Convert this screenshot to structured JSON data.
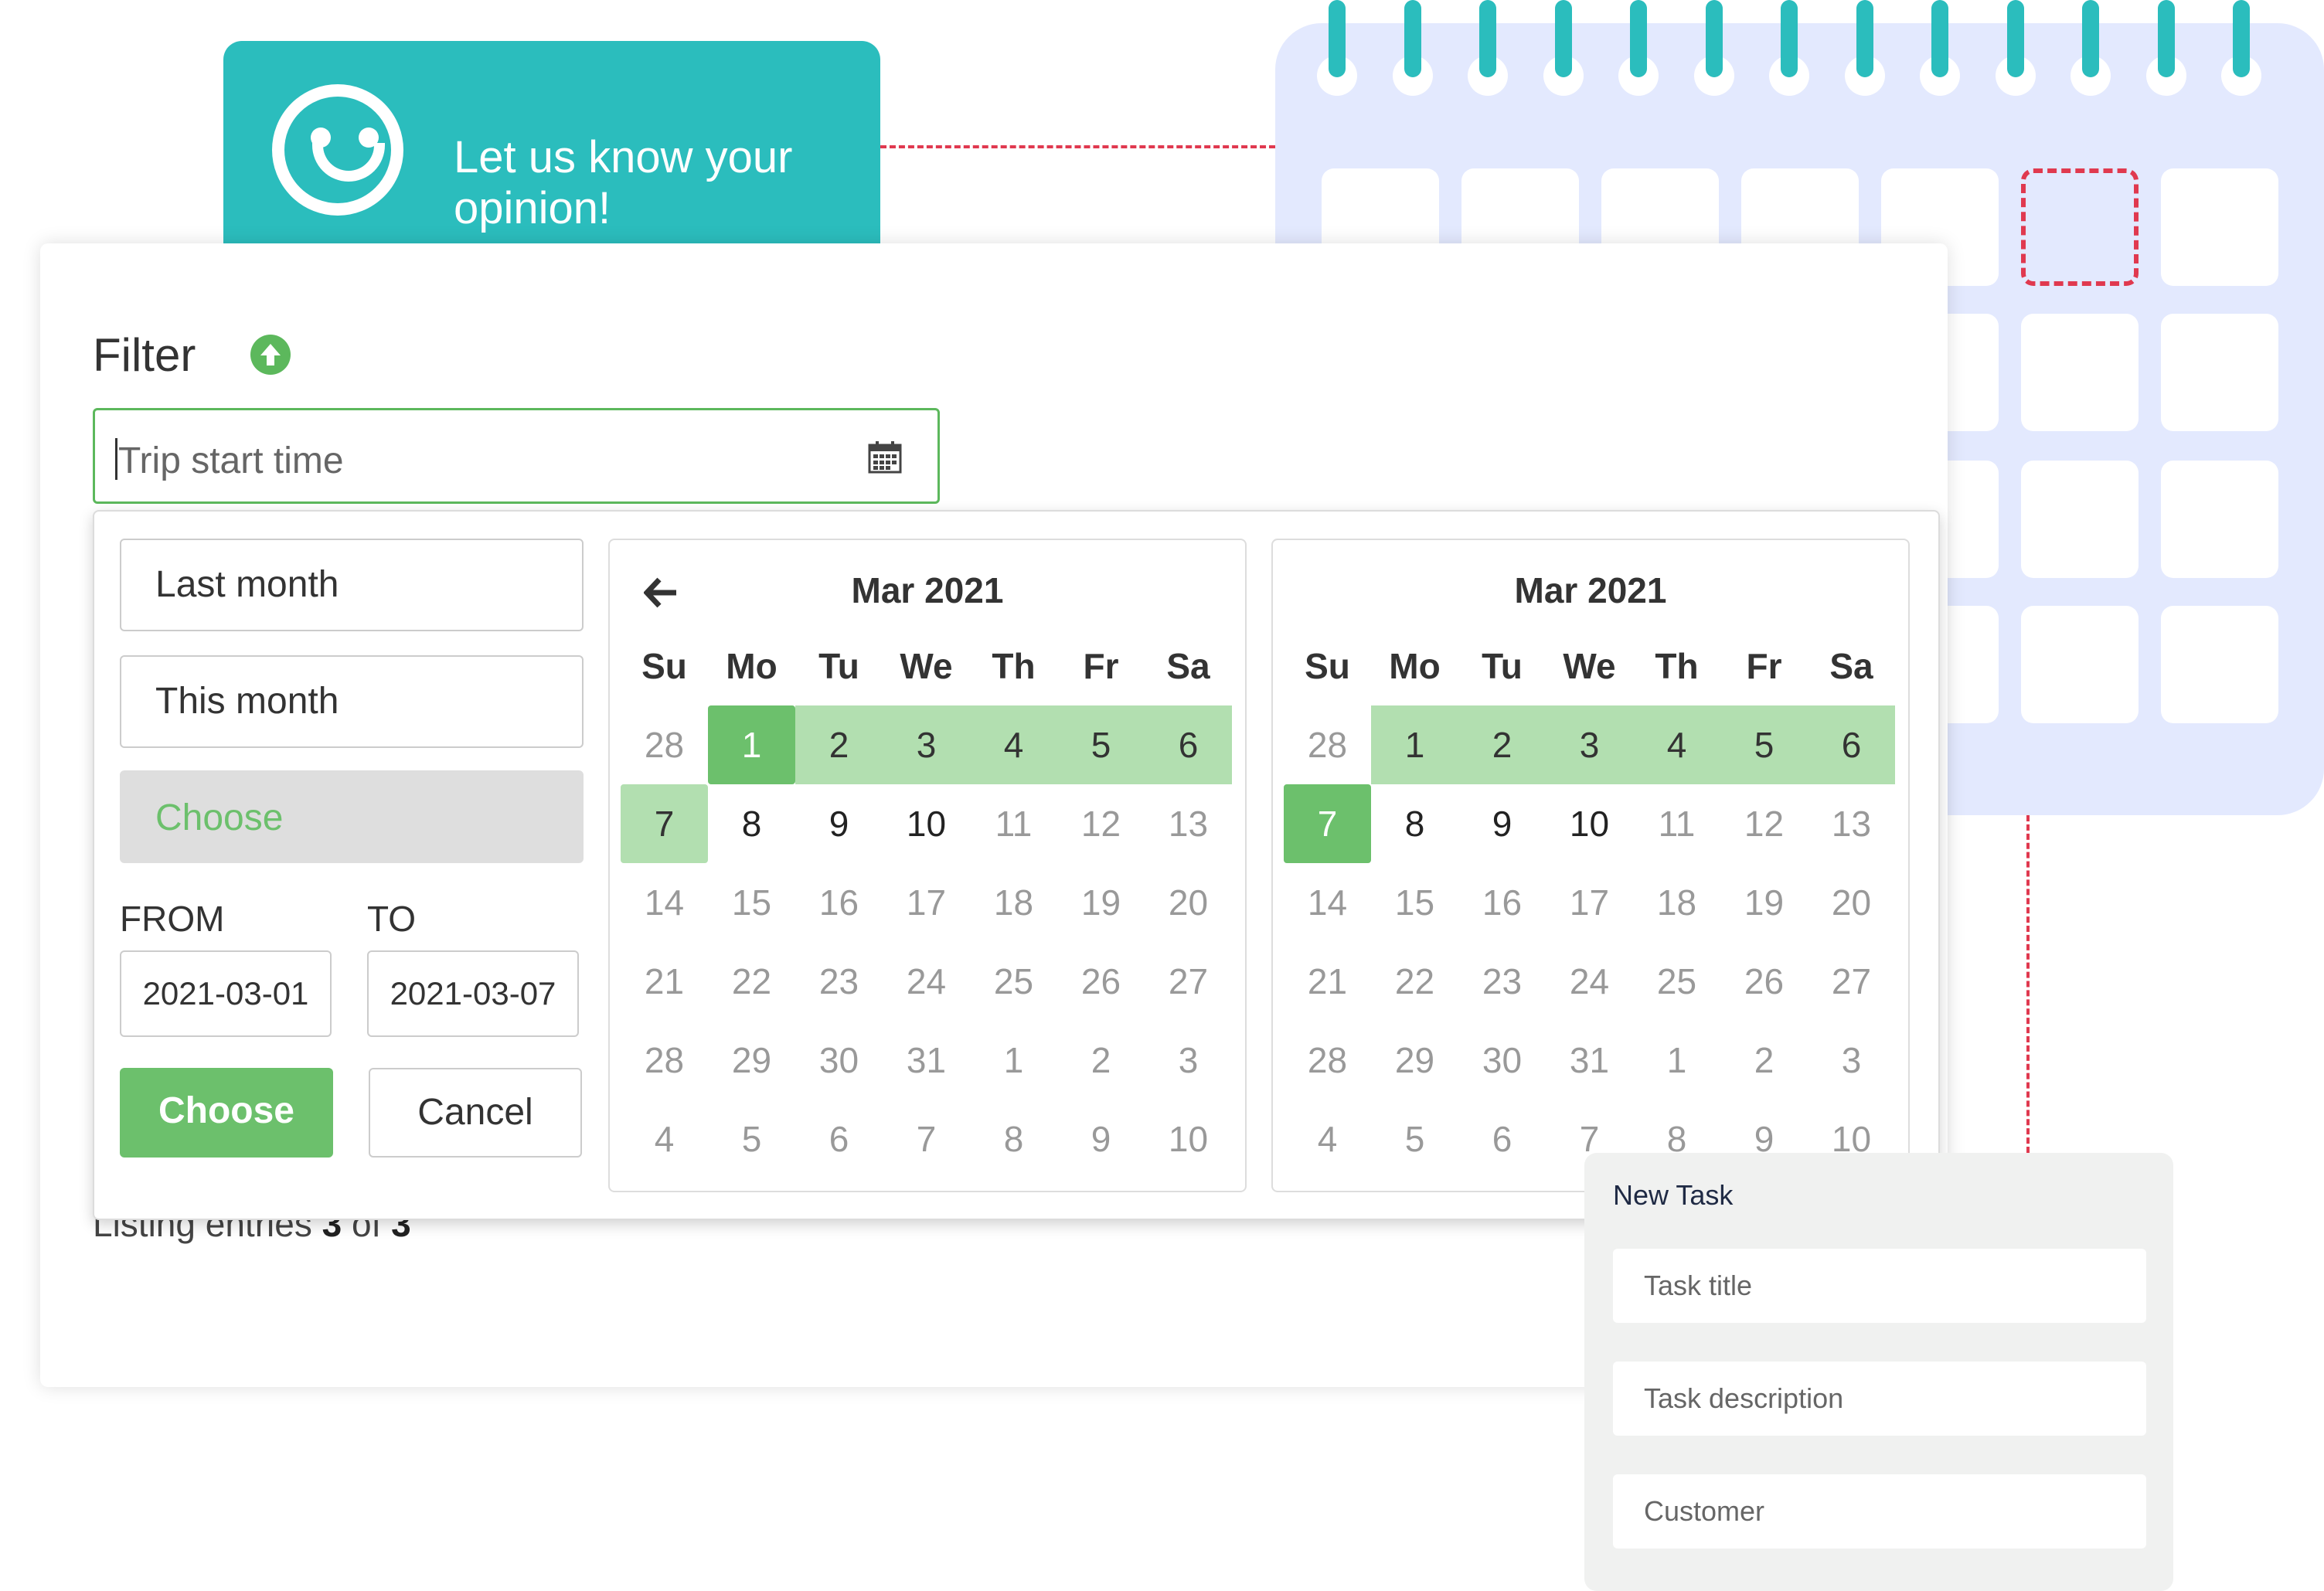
{
  "feedback": {
    "text": "Let us know your opinion!"
  },
  "filter": {
    "title": "Filter",
    "collapse_icon": "arrow-up-circle-icon",
    "trip_input": {
      "placeholder": "Trip start time",
      "icon": "calendar-icon"
    },
    "listing_prefix": "Listing entries ",
    "listing_shown": "3",
    "listing_of": " of ",
    "listing_total": "3"
  },
  "picker": {
    "ranges": [
      "Last month",
      "This month",
      "Choose"
    ],
    "active_range": "Choose",
    "from_label": "FROM",
    "to_label": "TO",
    "from_value": "2021-03-01",
    "to_value": "2021-03-07",
    "apply_label": "Choose",
    "cancel_label": "Cancel",
    "prev_icon": "arrow-left-icon",
    "weekdays": [
      "Su",
      "Mo",
      "Tu",
      "We",
      "Th",
      "Fr",
      "Sa"
    ],
    "calendars": [
      {
        "month_label": "Mar 2021",
        "has_prev": true,
        "weeks": [
          [
            "28",
            "1",
            "2",
            "3",
            "4",
            "5",
            "6"
          ],
          [
            "7",
            "8",
            "9",
            "10",
            "11",
            "12",
            "13"
          ],
          [
            "14",
            "15",
            "16",
            "17",
            "18",
            "19",
            "20"
          ],
          [
            "21",
            "22",
            "23",
            "24",
            "25",
            "26",
            "27"
          ],
          [
            "28",
            "29",
            "30",
            "31",
            "1",
            "2",
            "3"
          ],
          [
            "4",
            "5",
            "6",
            "7",
            "8",
            "9",
            "10"
          ]
        ],
        "states": [
          [
            "off",
            "sel",
            "inr",
            "inr",
            "inr",
            "inr",
            "inr"
          ],
          [
            "inr-l",
            "",
            "",
            "",
            "off",
            "off",
            "off"
          ],
          [
            "off",
            "off",
            "off",
            "off",
            "off",
            "off",
            "off"
          ],
          [
            "off",
            "off",
            "off",
            "off",
            "off",
            "off",
            "off"
          ],
          [
            "off",
            "off",
            "off",
            "off",
            "off",
            "off",
            "off"
          ],
          [
            "off",
            "off",
            "off",
            "off",
            "off",
            "off",
            "off"
          ]
        ]
      },
      {
        "month_label": "Mar 2021",
        "has_prev": false,
        "weeks": [
          [
            "28",
            "1",
            "2",
            "3",
            "4",
            "5",
            "6"
          ],
          [
            "7",
            "8",
            "9",
            "10",
            "11",
            "12",
            "13"
          ],
          [
            "14",
            "15",
            "16",
            "17",
            "18",
            "19",
            "20"
          ],
          [
            "21",
            "22",
            "23",
            "24",
            "25",
            "26",
            "27"
          ],
          [
            "28",
            "29",
            "30",
            "31",
            "1",
            "2",
            "3"
          ],
          [
            "4",
            "5",
            "6",
            "7",
            "8",
            "9",
            "10"
          ]
        ],
        "states": [
          [
            "off",
            "inr",
            "inr",
            "inr",
            "inr",
            "inr",
            "inr"
          ],
          [
            "sel",
            "",
            "",
            "",
            "off",
            "off",
            "off"
          ],
          [
            "off",
            "off",
            "off",
            "off",
            "off",
            "off",
            "off"
          ],
          [
            "off",
            "off",
            "off",
            "off",
            "off",
            "off",
            "off"
          ],
          [
            "off",
            "off",
            "off",
            "off",
            "off",
            "off",
            "off"
          ],
          [
            "off",
            "off",
            "off",
            "off",
            "off",
            "off",
            "off"
          ]
        ]
      }
    ]
  },
  "task": {
    "heading": "New Task",
    "fields": [
      "Task title",
      "Task description",
      "Customer"
    ]
  },
  "colors": {
    "teal": "#2bbdbd",
    "green": "#6cc06c",
    "range_green": "#b2dfb0",
    "calendar_bg": "#e3e9fe",
    "dash_red": "#e0394f"
  }
}
